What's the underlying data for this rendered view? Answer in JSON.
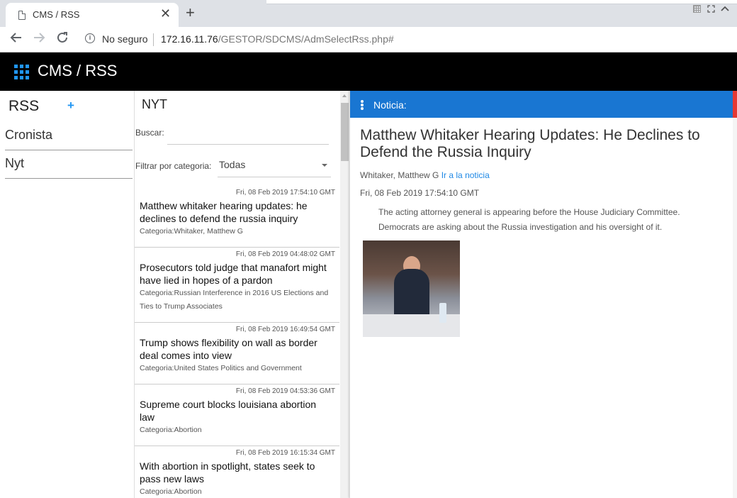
{
  "browser": {
    "tab_title": "CMS / RSS",
    "close_glyph": "✕",
    "new_tab_glyph": "+",
    "security_label": "No seguro",
    "url_host": "172.16.11.76",
    "url_path": "/GESTOR/SDCMS/AdmSelectRss.php#"
  },
  "app": {
    "title": "CMS / RSS"
  },
  "sidebar": {
    "title": "RSS",
    "add_glyph": "+",
    "feeds": [
      {
        "label": "Cronista"
      },
      {
        "label": "Nyt"
      }
    ]
  },
  "feed": {
    "title": "NYT",
    "search_label": "Buscar:",
    "search_value": "",
    "filter_label": "Filtrar por categoria:",
    "filter_value": "Todas",
    "items": [
      {
        "date": "Fri, 08 Feb 2019 17:54:10 GMT",
        "title": "Matthew whitaker hearing updates: he declines to defend the russia inquiry",
        "category": "Categoria:Whitaker, Matthew G"
      },
      {
        "date": "Fri, 08 Feb 2019 04:48:02 GMT",
        "title": "Prosecutors told judge that manafort might have lied in hopes of a pardon",
        "category": "Categoria:Russian Interference in 2016 US Elections and Ties to Trump Associates"
      },
      {
        "date": "Fri, 08 Feb 2019 16:49:54 GMT",
        "title": "Trump shows flexibility on wall as border deal comes into view",
        "category": "Categoria:United States Politics and Government"
      },
      {
        "date": "Fri, 08 Feb 2019 04:53:36 GMT",
        "title": "Supreme court blocks louisiana abortion law",
        "category": "Categoria:Abortion"
      },
      {
        "date": "Fri, 08 Feb 2019 16:15:34 GMT",
        "title": "With abortion in spotlight, states seek to pass new laws",
        "category": "Categoria:Abortion"
      }
    ]
  },
  "article": {
    "panel_label": "Noticia:",
    "title": "Matthew Whitaker Hearing Updates: He Declines to Defend the Russia Inquiry",
    "author": "Whitaker, Matthew G",
    "link_label": "Ir a la noticia",
    "date": "Fri, 08 Feb 2019 17:54:10 GMT",
    "body": "The acting attorney general is appearing before the House Judiciary Committee. Democrats are asking about the Russia investigation and his oversight of it."
  },
  "colors": {
    "accent": "#1976d2",
    "apps_icon": "#2196f3",
    "link": "#1e88e5",
    "header_bg": "#000000"
  }
}
